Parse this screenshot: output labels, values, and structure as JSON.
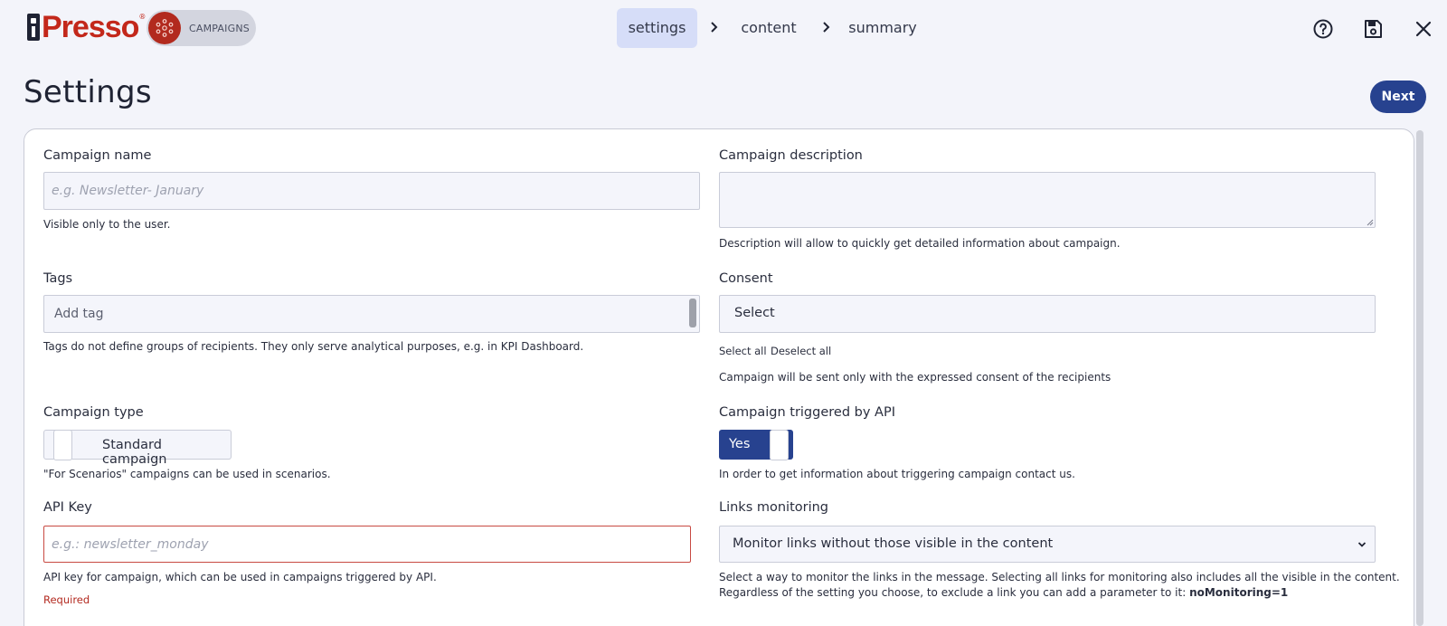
{
  "brand": {
    "logo_text": "Presso",
    "module_label": "CAMPAIGNS",
    "accent": "#27428f",
    "brand_red": "#c3281b"
  },
  "steps": [
    {
      "label": "settings",
      "active": true
    },
    {
      "label": "content",
      "active": false
    },
    {
      "label": "summary",
      "active": false
    }
  ],
  "top_icons": [
    "help-circle-icon",
    "save-icon",
    "close-icon"
  ],
  "page": {
    "title": "Settings",
    "next_label": "Next"
  },
  "form": {
    "campaign_name": {
      "label": "Campaign name",
      "placeholder": "e.g. Newsletter- January",
      "value": "",
      "help": "Visible only to the user."
    },
    "campaign_description": {
      "label": "Campaign description",
      "value": "",
      "help": "Description will allow to quickly get detailed information about campaign."
    },
    "tags": {
      "label": "Tags",
      "placeholder": "Add tag",
      "help": "Tags do not define groups of recipients. They only serve analytical purposes, e.g. in KPI Dashboard."
    },
    "consent": {
      "label": "Consent",
      "value": "Select",
      "select_all": "Select all",
      "deselect_all": "Deselect all",
      "help": "Campaign will be sent only with the expressed consent of the recipients"
    },
    "campaign_type": {
      "label": "Campaign type",
      "value": "Standard campaign",
      "help": "\"For Scenarios\" campaigns can be used in scenarios."
    },
    "triggered_by_api": {
      "label": "Campaign triggered by API",
      "value": "Yes",
      "help": "In order to get information about triggering campaign contact us."
    },
    "api_key": {
      "label": "API Key",
      "placeholder": "e.g.: newsletter_monday",
      "value": "",
      "help": "API key for campaign, which can be used in campaigns triggered by API.",
      "error": "Required"
    },
    "links_monitoring": {
      "label": "Links monitoring",
      "value": "Monitor links without those visible in the content",
      "help_line1": "Select a way to monitor the links in the message. Selecting all links for monitoring also includes all the visible in the content.",
      "help_line2": "Regardless of the setting you choose, to exclude a link you can add a parameter to it:",
      "help_param": "noMonitoring=1"
    }
  }
}
